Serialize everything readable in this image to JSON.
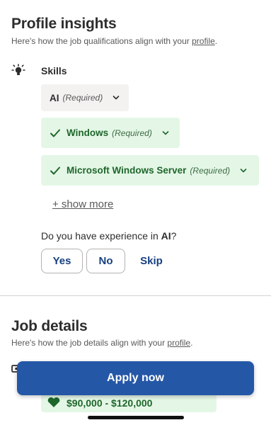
{
  "profile_insights": {
    "title": "Profile insights",
    "subtitle_prefix": "Here's how the job qualifications align with your ",
    "subtitle_link": "profile",
    "subtitle_suffix": ".",
    "skills_label": "Skills",
    "skills": [
      {
        "name": "AI",
        "qualifier": "(Required)",
        "status": "unmatched"
      },
      {
        "name": "Windows",
        "qualifier": "(Required)",
        "status": "matched"
      },
      {
        "name": "Microsoft Windows Server",
        "qualifier": "(Required)",
        "status": "matched"
      }
    ],
    "show_more": "+ show more",
    "question_prefix": "Do you have experience in ",
    "question_skill": "AI",
    "question_suffix": "?",
    "answers": {
      "yes": "Yes",
      "no": "No",
      "skip": "Skip"
    }
  },
  "job_details": {
    "title": "Job details",
    "subtitle_prefix": "Here's how the job details align with your ",
    "subtitle_link": "profile",
    "subtitle_suffix": ".",
    "salary_partial": "$90,000 - $120,000"
  },
  "apply_button": "Apply now",
  "colors": {
    "primary": "#2557a7",
    "match_bg": "#e4f7e6",
    "match_text": "#1f662c",
    "neutral_chip": "#f3f2f1",
    "button_text": "#164081"
  }
}
